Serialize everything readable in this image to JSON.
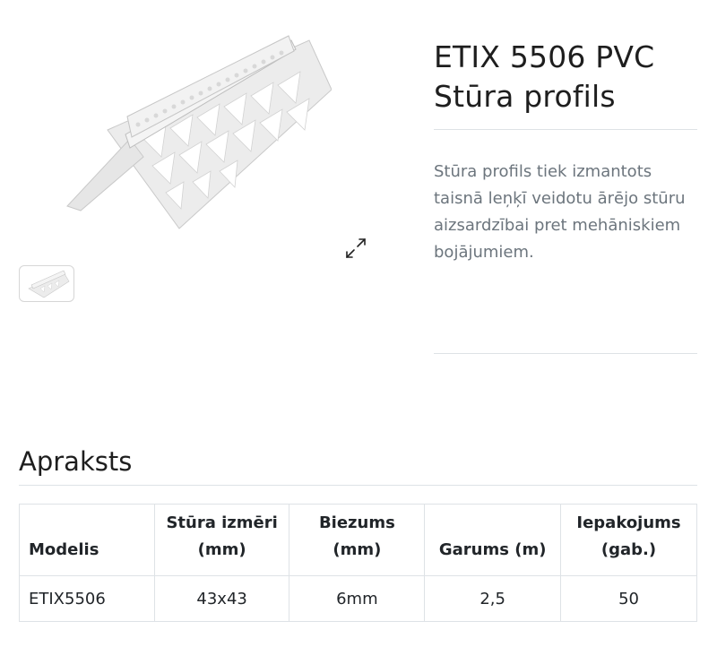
{
  "product": {
    "title_line1": "ETIX 5506 PVC",
    "title_line2": "Stūra profils",
    "description": "Stūra profils tiek izmantots taisnā leņķī veidotu ārējo stūru aizsardzībai pret mehāniskiem bojājumiem."
  },
  "gallery": {
    "main_image_icon": "corner-profile-image",
    "zoom_icon": "expand-arrows-icon",
    "thumbnail_icon": "corner-profile-thumbnail"
  },
  "section": {
    "title": "Apraksts"
  },
  "table": {
    "headers": [
      {
        "line1": "Modelis",
        "line2": ""
      },
      {
        "line1": "Stūra izmēri",
        "line2": "(mm)"
      },
      {
        "line1": "Biezums",
        "line2": "(mm)"
      },
      {
        "line1": "Garums (m)",
        "line2": ""
      },
      {
        "line1": "Iepakojums",
        "line2": "(gab.)"
      }
    ],
    "rows": [
      [
        "ETIX5506",
        "43x43",
        "6mm",
        "2,5",
        "50"
      ]
    ]
  }
}
